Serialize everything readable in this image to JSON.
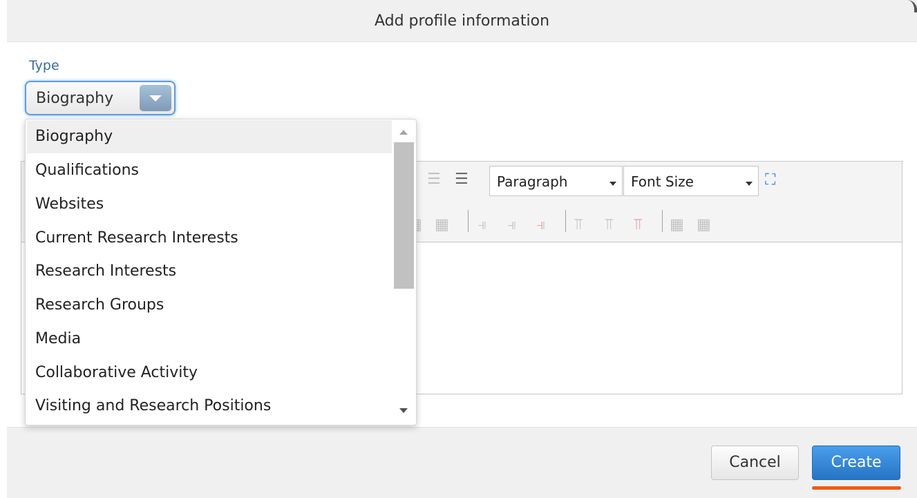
{
  "dialog": {
    "title": "Add profile information"
  },
  "form": {
    "type_label": "Type",
    "type_value": "Biography"
  },
  "dropdown": {
    "options": [
      "Biography",
      "Qualifications",
      "Websites",
      "Current Research Interests",
      "Research Interests",
      "Research Groups",
      "Media",
      "Collaborative Activity",
      "Visiting and Research Positions"
    ],
    "selected": "Biography"
  },
  "editor": {
    "block_format": "Paragraph",
    "font_size": "Font Size"
  },
  "footer": {
    "cancel_label": "Cancel",
    "create_label": "Create"
  },
  "colors": {
    "accent": "#2574c6",
    "focus_ring": "#5e9ee0",
    "underline": "#f15a1a",
    "label": "#3d6aa3"
  },
  "icons": [
    "outdent-icon",
    "indent-icon",
    "fullscreen-icon",
    "table-cell-icon",
    "row-insert-icon",
    "column-insert-icon",
    "table-icon"
  ]
}
